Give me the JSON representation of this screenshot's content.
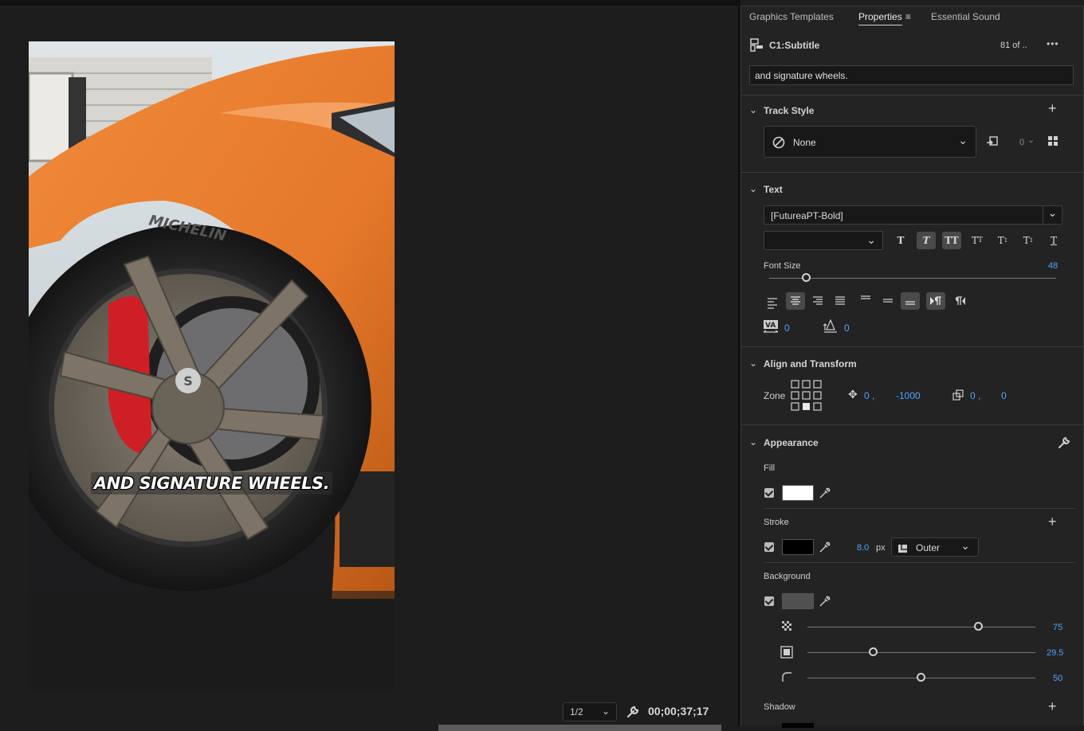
{
  "program": {
    "caption": "AND SIGNATURE WHEELS.",
    "resolution": "1/2",
    "timecode": "00;00;37;17"
  },
  "panel": {
    "tabs": [
      {
        "label": "Graphics Templates",
        "active": false
      },
      {
        "label": "Properties",
        "active": true
      },
      {
        "label": "Essential Sound",
        "active": false
      }
    ],
    "clip": {
      "name": "C1:Subtitle",
      "counter": "81 of ..",
      "more": "•••"
    },
    "text_value": "and signature wheels.",
    "track_style": {
      "title": "Track Style",
      "value": "None",
      "count": "0"
    },
    "text_section": {
      "title": "Text",
      "font": "[FutureaPT-Bold]",
      "font_style": "",
      "font_size_label": "Font Size",
      "font_size": "48",
      "font_size_fraction": 0.13,
      "tracking": "0",
      "leading": "0"
    },
    "align": {
      "title": "Align and Transform",
      "zone_label": "Zone",
      "position_x": "0 ,",
      "position_y": "-1000",
      "scale_x": "0 ,",
      "scale_y": "0"
    },
    "appearance": {
      "title": "Appearance",
      "fill_label": "Fill",
      "fill_color": "#ffffff",
      "stroke_label": "Stroke",
      "stroke_color": "#000000",
      "stroke_width": "8.0",
      "stroke_unit": "px",
      "stroke_type": "Outer",
      "background_label": "Background",
      "background_color": "#505050",
      "opacity": "75",
      "opacity_fraction": 0.75,
      "size": "29.5",
      "size_fraction": 0.29,
      "corner": "50",
      "corner_fraction": 0.5,
      "shadow_label": "Shadow"
    }
  },
  "colors": {
    "accent": "#4ea4ff",
    "panel_bg": "#232323"
  }
}
